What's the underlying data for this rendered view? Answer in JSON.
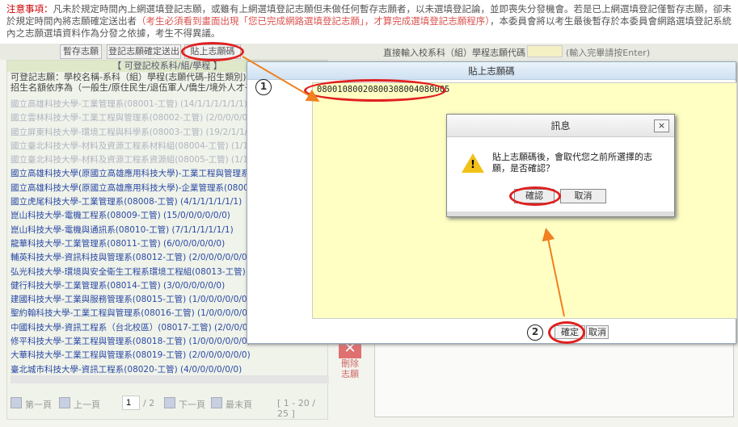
{
  "notice": {
    "label": "注意事項：",
    "text1": "凡未於規定時間內上網選填登記志願，或雖有上網選填登記志願但未做任何暫存志願者，以未選填登記論，並即喪失分發機會。若是已上網選填登記僅暫存志願，卻未於規定時間內將志願確定送出者",
    "red1": "（考生必須看到畫面出現「您已完成網路選填登記志願」，才算完成選填登記志願程序）",
    "text2": "，本委員會將以考生最後暫存於本委員會網路選填登記系統內之志願選填資料作為分發之依據，考生不得異議。"
  },
  "toolbar": {
    "save_temp": "暫存志願",
    "confirm_submit": "登記志願確定送出",
    "paste_code": "貼上志願碼",
    "direct_input_label": "直接輸入校系科（組）學程志願代碼：",
    "input_hint": "(輸入完畢請按Enter)"
  },
  "left_panel": {
    "header": "【 可登記校系科/組/學程 】",
    "sub1": "可登記志願：學校名稱-系科（組）學程(志願代碼-招生類別)(限制)",
    "sub2": "招生名額依序為（一般生/原住民生/退伍軍人/僑生/境外人才子女/...）",
    "items": [
      {
        "text": "國立高雄科技大學-工業管理系(08001-工管) (14/1/1/1/1/1/1)",
        "dim": true
      },
      {
        "text": "國立雲林科技大學-工業工程與管理系(08002-工管) (2/0/0/0/0/0/0)",
        "dim": true
      },
      {
        "text": "國立屏東科技大學-環境工程與科學系(08003-工管) (19/2/1/1/1/1/1)",
        "dim": true
      },
      {
        "text": "國立臺北科技大學-材料及資源工程系材料組(08004-工管) (1/1/1/1/1)",
        "dim": true
      },
      {
        "text": "國立臺北科技大學-材料及資源工程系資源組(08005-工管) (1/1/1/1/1)",
        "dim": true
      },
      {
        "text": "國立高雄科技大學(原國立高雄應用科技大學)-工業工程與管理系(08006-工管)",
        "dim": false
      },
      {
        "text": "國立高雄科技大學(原國立高雄應用科技大學)-企業管理系(08007-工管)",
        "dim": false
      },
      {
        "text": "國立虎尾科技大學-工業管理系(08008-工管) (4/1/1/1/1/1/1)",
        "dim": false
      },
      {
        "text": "崑山科技大學-電機工程系(08009-工管) (15/0/0/0/0/0/0)",
        "dim": false
      },
      {
        "text": "崑山科技大學-電機與通訊系(08010-工管) (7/1/1/1/1/1/1)",
        "dim": false
      },
      {
        "text": "龍華科技大學-工業管理系(08011-工管) (6/0/0/0/0/0/0)",
        "dim": false
      },
      {
        "text": "輔英科技大學-資訊科技與管理系(08012-工管) (2/0/0/0/0/0/0)",
        "dim": false
      },
      {
        "text": "弘光科技大學-環境與安全衛生工程系環境工程組(08013-工管) (5/...)",
        "dim": false
      },
      {
        "text": "健行科技大學-工業管理系(08014-工管) (3/0/0/0/0/0/0)",
        "dim": false
      },
      {
        "text": "建國科技大學-工業與服務管理系(08015-工管) (1/0/0/0/0/0/0)",
        "dim": false
      },
      {
        "text": "聖約翰科技大學-工業工程與管理系(08016-工管) (1/0/0/0/0/0/0)",
        "dim": false
      },
      {
        "text": "中國科技大學-資訊工程系（台北校區）(08017-工管) (2/0/0/0/0/0/0)",
        "dim": false
      },
      {
        "text": "修平科技大學-工業工程與管理系(08018-工管) (1/0/0/0/0/0/0)",
        "dim": false
      },
      {
        "text": "大華科技大學-工業工程與管理系(08019-工管) (2/0/0/0/0/0/0)",
        "dim": false
      },
      {
        "text": "臺北城市科技大學-資訊工程系(08020-工管) (4/0/0/0/0/0/0)",
        "dim": false
      }
    ]
  },
  "pager": {
    "first": "第一頁",
    "prev": "上一頁",
    "page": "1",
    "total": "/ 2",
    "next": "下一頁",
    "last": "最末頁",
    "range": "[ 1 - 20 / 25 ]"
  },
  "delete": {
    "label1": "刪除",
    "label2": "志願",
    "icon": "x-icon"
  },
  "paste_dialog": {
    "title": "貼上志願碼",
    "code": "08001080020800308004080005",
    "ok": "確定",
    "cancel": "取消"
  },
  "message_box": {
    "title": "訊息",
    "close": "×",
    "text": "貼上志願碼後，會取代您之前所選擇的志願，是否確認？",
    "ok": "確認",
    "cancel": "取消"
  },
  "annotations": {
    "step1": "1",
    "step2": "2",
    "highlight_color": "#e02020",
    "arrow_color": "#f08020"
  }
}
